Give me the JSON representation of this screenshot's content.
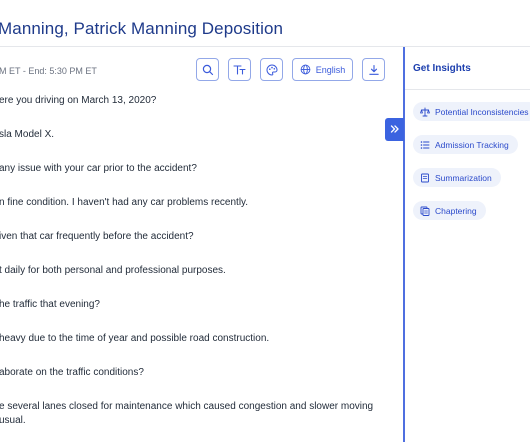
{
  "header": {
    "title": "Manning, Patrick Manning Deposition"
  },
  "toolbar": {
    "time_range": "M ET - End: 5:30 PM ET",
    "language_label": "English",
    "icons": [
      "search-icon",
      "text-size-icon",
      "palette-icon",
      "globe-icon",
      "download-icon"
    ]
  },
  "transcript": {
    "lines": [
      "ere you driving on March 13, 2020?",
      "sla Model X.",
      "any issue with your car prior to the accident?",
      "n fine condition. I haven't had any car problems recently.",
      "iven that car frequently before the accident?",
      "t daily for both personal and professional purposes.",
      "he traffic that evening?",
      "heavy due to the time of year and possible road construction.",
      "aborate on the traffic conditions?",
      "e several lanes closed for maintenance which caused congestion and slower moving",
      " usual."
    ]
  },
  "insights": {
    "title": "Get Insights",
    "items": [
      {
        "label": "Potential Inconsistencies",
        "icon": "scale-icon"
      },
      {
        "label": "Admission Tracking",
        "icon": "list-icon"
      },
      {
        "label": "Summarization",
        "icon": "document-icon"
      },
      {
        "label": "Chaptering",
        "icon": "chapter-icon"
      }
    ]
  },
  "colors": {
    "accent": "#3b63e0",
    "title": "#1e3a8a",
    "chip_bg": "#eef2fb",
    "chip_text": "#2b4acb",
    "divider": "#4f6fe0"
  }
}
